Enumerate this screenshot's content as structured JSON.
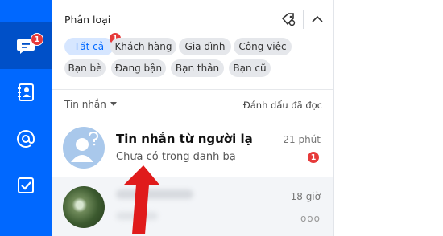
{
  "colors": {
    "brand": "#0068ff",
    "badge": "#e63a3a"
  },
  "nav": {
    "items": [
      {
        "icon": "chat-icon",
        "badge": "1"
      },
      {
        "icon": "contacts-icon"
      },
      {
        "icon": "at-mention-icon"
      },
      {
        "icon": "todo-check-icon"
      }
    ]
  },
  "filter": {
    "title": "Phân loại",
    "tag_icon": "tag-settings-icon",
    "collapse_icon": "chevron-up-icon",
    "chips": [
      {
        "label": "Tất cả",
        "badge": "1",
        "active": true
      },
      {
        "label": "Khách hàng"
      },
      {
        "label": "Gia đình"
      },
      {
        "label": "Công việc"
      },
      {
        "label": "Bạn bè"
      },
      {
        "label": "Đang bận"
      },
      {
        "label": "Bạn thân"
      },
      {
        "label": "Bạn cũ"
      }
    ]
  },
  "messages": {
    "header": "Tin nhắn",
    "mark_read": "Đánh dấu đã đọc",
    "conversations": [
      {
        "name": "Tin nhắn từ người lạ",
        "preview": "Chưa có trong danh bạ",
        "time": "21 phút",
        "unread": "1"
      },
      {
        "time": "18 giờ",
        "more": "ooo"
      }
    ]
  }
}
